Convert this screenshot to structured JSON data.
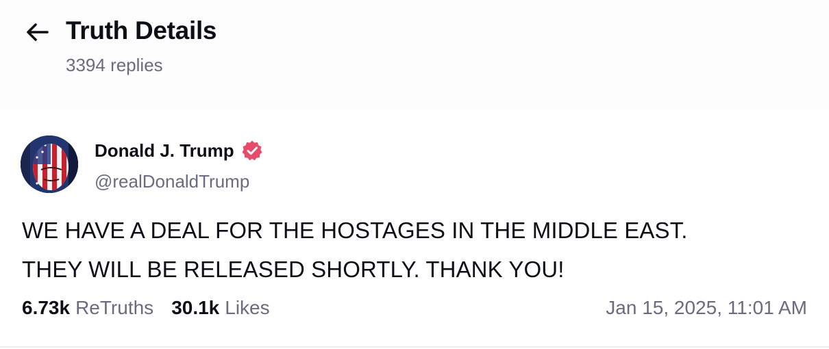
{
  "header": {
    "title": "Truth Details",
    "replies": "3394 replies",
    "back_icon": "arrow-left-icon"
  },
  "post": {
    "author_name": "Donald J. Trump",
    "handle": "@realDonaldTrump",
    "verified_icon": "verified-badge-icon",
    "verified_color": "#e64b6a",
    "body_lines": [
      "WE HAVE A DEAL FOR THE HOSTAGES IN THE MIDDLE EAST.",
      "THEY WILL BE RELEASED SHORTLY. THANK YOU!"
    ],
    "retruths_count": "6.73k",
    "retruths_label": "ReTruths",
    "likes_count": "30.1k",
    "likes_label": "Likes",
    "timestamp": "Jan 15, 2025, 11:01 AM"
  },
  "colors": {
    "text_primary": "#0e0e16",
    "text_secondary": "#6b6b7d",
    "header_bg": "#fdfdfe"
  }
}
